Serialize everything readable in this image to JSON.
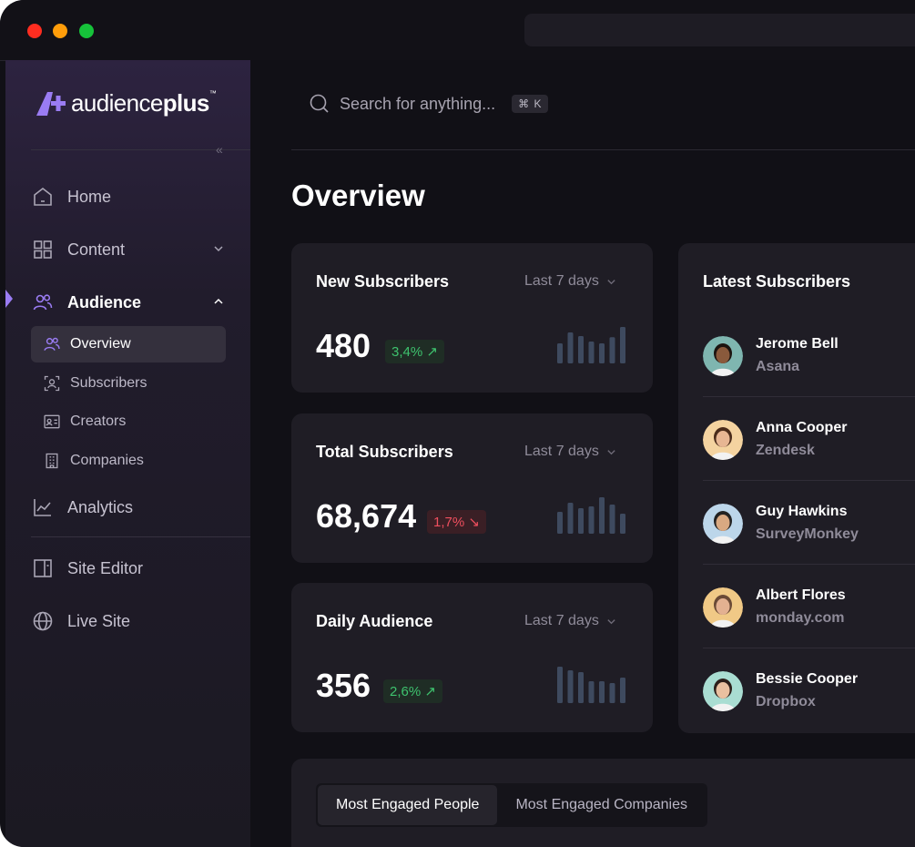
{
  "brand": {
    "name_light": "audience",
    "name_bold": "plus",
    "tm": "™",
    "accent": "#9a7cf3"
  },
  "search": {
    "placeholder": "Search for anything...",
    "shortcut": "⌘ K"
  },
  "sidebar": {
    "items": [
      {
        "label": "Home",
        "icon": "home-icon"
      },
      {
        "label": "Content",
        "icon": "grid-icon"
      },
      {
        "label": "Audience",
        "icon": "users-icon"
      },
      {
        "label": "Analytics",
        "icon": "line-chart-icon"
      },
      {
        "label": "Site Editor",
        "icon": "layout-icon"
      },
      {
        "label": "Live Site",
        "icon": "globe-icon"
      }
    ],
    "audience_sub": [
      {
        "label": "Overview",
        "icon": "users-icon"
      },
      {
        "label": "Subscribers",
        "icon": "user-frame-icon"
      },
      {
        "label": "Creators",
        "icon": "id-card-icon"
      },
      {
        "label": "Companies",
        "icon": "building-icon"
      }
    ]
  },
  "page": {
    "title": "Overview"
  },
  "stats": [
    {
      "title": "New Subscribers",
      "period": "Last 7 days",
      "value": "480",
      "change": "3,4%",
      "trend": "up",
      "bars": [
        0.55,
        0.85,
        0.75,
        0.6,
        0.55,
        0.72,
        1.0
      ]
    },
    {
      "title": "Total Subscribers",
      "period": "Last 7 days",
      "value": "68,674",
      "change": "1,7%",
      "trend": "down",
      "bars": [
        0.6,
        0.85,
        0.7,
        0.75,
        1.0,
        0.8,
        0.55
      ]
    },
    {
      "title": "Daily Audience",
      "period": "Last 7 days",
      "value": "356",
      "change": "2,6%",
      "trend": "up",
      "bars": [
        1.0,
        0.9,
        0.85,
        0.6,
        0.6,
        0.55,
        0.7
      ]
    }
  ],
  "latest": {
    "title": "Latest Subscribers",
    "people": [
      {
        "name": "Jerome Bell",
        "company": "Asana",
        "bg": "#7fb6b0",
        "skin": "#8a5a3c",
        "hair": "#1c1410"
      },
      {
        "name": "Anna Cooper",
        "company": "Zendesk",
        "bg": "#f4d3a0",
        "skin": "#e7b693",
        "hair": "#4a2b1a"
      },
      {
        "name": "Guy Hawkins",
        "company": "SurveyMonkey",
        "bg": "#bcd6ea",
        "skin": "#d9a982",
        "hair": "#222222"
      },
      {
        "name": "Albert Flores",
        "company": "monday.com",
        "bg": "#f0c986",
        "skin": "#e3b191",
        "hair": "#6a4a36"
      },
      {
        "name": "Bessie Cooper",
        "company": "Dropbox",
        "bg": "#a9ddd2",
        "skin": "#e9c0a0",
        "hair": "#2c1f1a"
      }
    ]
  },
  "engaged": {
    "tabs": [
      "Most Engaged People",
      "Most Engaged Companies"
    ]
  }
}
